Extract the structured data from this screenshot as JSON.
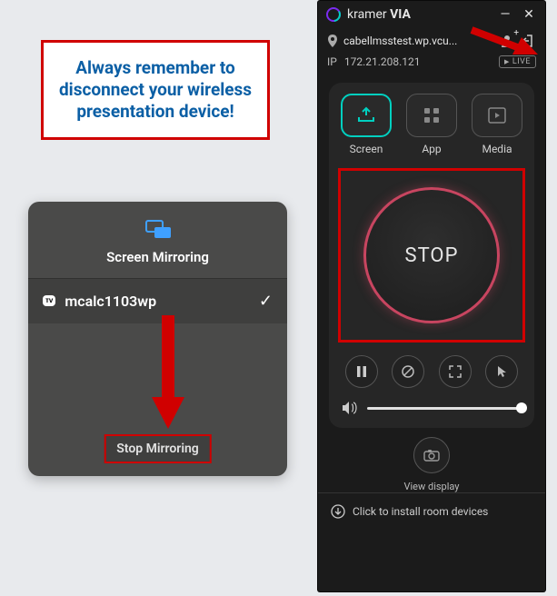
{
  "callout": {
    "text": "Always remember to disconnect your wireless presentation device!"
  },
  "mirror": {
    "title": "Screen Mirroring",
    "device_badge": "ᴛᴠ",
    "device_name": "mcalc1103wp",
    "checkmark": "✓",
    "stop_label": "Stop Mirroring"
  },
  "via": {
    "brand_prefix": "kramer ",
    "brand_bold": "VIA",
    "window": {
      "minimize": "—",
      "close": "✕"
    },
    "connection": {
      "host": "cabellmsstest.wp.vcu...",
      "add_user": "+"
    },
    "ip_label": "IP",
    "ip_value": "172.21.208.121",
    "live_badge": "LIVE",
    "tabs": {
      "screen": "Screen",
      "app": "App",
      "media": "Media"
    },
    "stop_button": "STOP",
    "view_display": "View display",
    "install": "Click to install room devices"
  },
  "colors": {
    "red": "#d00000",
    "blue": "#0b5fa5",
    "teal": "#00d0c0"
  }
}
